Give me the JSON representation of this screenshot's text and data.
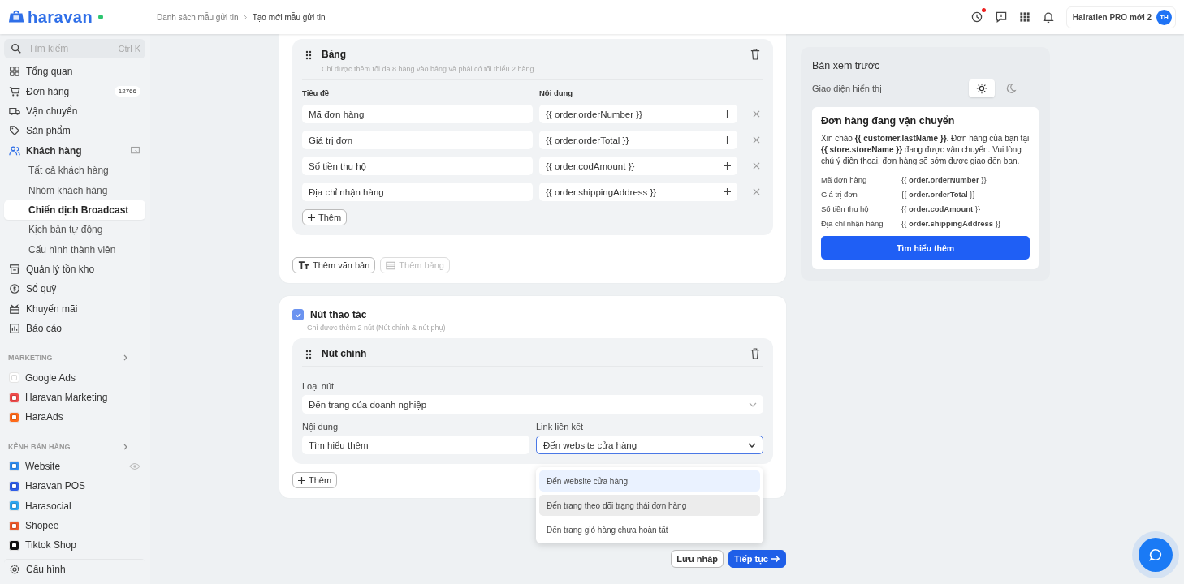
{
  "brand": {
    "name": "haravan",
    "online": true
  },
  "breadcrumb": [
    "Danh sách mẫu gửi tin",
    "Tạo mới mẫu gửi tin"
  ],
  "topbar": {
    "notification_dot": true,
    "store_name": "Hairatien PRO mới 2",
    "avatar": "TH"
  },
  "sidebar": {
    "search": {
      "placeholder": "Tìm kiếm",
      "shortcut": "Ctrl K"
    },
    "items": [
      {
        "label": "Tổng quan",
        "selected": false
      },
      {
        "label": "Đơn hàng",
        "selected": false,
        "badge": "12766"
      },
      {
        "label": "Vận chuyển",
        "selected": false
      },
      {
        "label": "Sản phẩm",
        "selected": false
      },
      {
        "label": "Khách hàng",
        "selected": true,
        "children": [
          {
            "label": "Tất cả khách hàng",
            "selected": false
          },
          {
            "label": "Nhóm khách hàng",
            "selected": false
          },
          {
            "label": "Chiến dịch Broadcast",
            "selected": true
          },
          {
            "label": "Kịch bản tự động",
            "selected": false
          },
          {
            "label": "Cấu hình thành viên",
            "selected": false
          }
        ]
      },
      {
        "label": "Quản lý tồn kho",
        "selected": false
      },
      {
        "label": "Sổ quỹ",
        "selected": false
      },
      {
        "label": "Khuyến mãi",
        "selected": false
      },
      {
        "label": "Báo cáo",
        "selected": false
      }
    ],
    "sections": [
      {
        "title": "MARKETING",
        "items": [
          {
            "label": "Google Ads",
            "color": "#ffffff"
          },
          {
            "label": "Haravan Marketing",
            "color": "#ef4b4b"
          },
          {
            "label": "HaraAds",
            "color": "#ff6a1a"
          }
        ]
      },
      {
        "title": "KÊNH BÁN HÀNG",
        "items": [
          {
            "label": "Website",
            "color": "#2f8cf0"
          },
          {
            "label": "Haravan POS",
            "color": "#2f5de8"
          },
          {
            "label": "Harasocial",
            "color": "#2ea6f0"
          },
          {
            "label": "Shopee",
            "color": "#ee5a2a"
          },
          {
            "label": "Tiktok Shop",
            "color": "#111111"
          }
        ]
      }
    ],
    "footer_item": "Cấu hình"
  },
  "table_block": {
    "title": "Bảng",
    "hint": "Chỉ được thêm tối đa 8 hàng vào bảng và phải có tối thiểu 2 hàng.",
    "columns": [
      "Tiêu đề",
      "Nội dung"
    ],
    "rows": [
      {
        "title": "Mã đơn hàng",
        "content": "{{ order.orderNumber }}"
      },
      {
        "title": "Giá trị đơn",
        "content": "{{ order.orderTotal }}"
      },
      {
        "title": "Số tiền thu hộ",
        "content": "{{ order.codAmount }}"
      },
      {
        "title": "Địa chỉ nhận hàng",
        "content": "{{ order.shippingAddress }}"
      }
    ],
    "add_button": "Thêm"
  },
  "block_toolbar": [
    {
      "label": "Thêm văn bản",
      "disabled": false
    },
    {
      "label": "Thêm bảng",
      "disabled": true
    }
  ],
  "action_buttons": {
    "checked": true,
    "title": "Nút thao tác",
    "hint": "Chỉ được thêm 2 nút (Nút chính & nút phụ)",
    "primary": {
      "title": "Nút chính",
      "button_type": {
        "label": "Loại nút",
        "value": "Đến trang của doanh nghiệp"
      },
      "content": {
        "label": "Nội dung",
        "value": "Tìm hiểu thêm"
      },
      "link": {
        "label": "Link liên kết",
        "value": "Đến website cửa hàng",
        "expanded": true,
        "options": [
          {
            "label": "Đến website cửa hàng",
            "selected": true,
            "hovered": false
          },
          {
            "label": "Đến trang theo dõi trạng thái đơn hàng",
            "selected": false,
            "hovered": true
          },
          {
            "label": "Đến trang giỏ hàng chưa hoàn tất",
            "selected": false,
            "hovered": false
          }
        ]
      }
    },
    "add_button": "Thêm"
  },
  "footer_buttons": [
    "Lưu nháp",
    "Tiếp tục"
  ],
  "preview": {
    "title": "Bản xem trước",
    "theme_label": "Giao diện hiển thị",
    "themes": [
      {
        "kind": "light",
        "selected": true
      },
      {
        "kind": "dark",
        "selected": false
      }
    ],
    "message": {
      "title": "Đơn hàng đang vận chuyển",
      "body": "Xin chào **{{ customer.lastName }}**. Đơn hàng của bạn tại **{{ store.storeName }}** đang được vận chuyển. Vui lòng chú ý điện thoại, đơn hàng sẽ sớm được giao đến bạn.",
      "rows": [
        {
          "label": "Mã đơn hàng",
          "value": "{{ **order.orderNumber** }}"
        },
        {
          "label": "Giá trị đơn",
          "value": "{{ **order.orderTotal** }}"
        },
        {
          "label": "Số tiền thu hộ",
          "value": "{{ **order.codAmount** }}"
        },
        {
          "label": "Địa chỉ nhận hàng",
          "value": "{{ **order.shippingAddress** }}"
        }
      ],
      "button": "Tìm hiểu thêm"
    }
  }
}
